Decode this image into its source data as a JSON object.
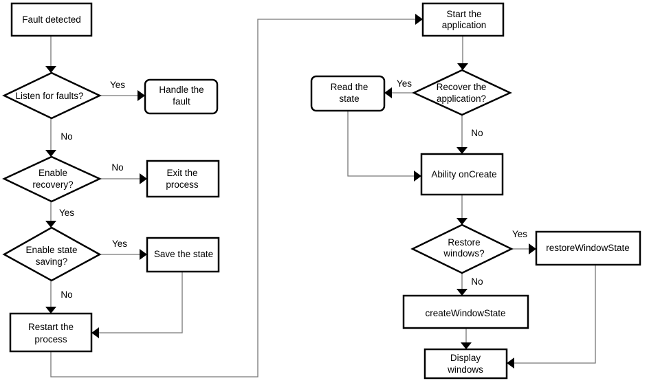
{
  "nodes": {
    "fault_detected": [
      "Fault detected"
    ],
    "listen_for_faults": [
      "Listen for faults?"
    ],
    "handle_fault": [
      "Handle the",
      "fault"
    ],
    "enable_recovery": [
      "Enable",
      "recovery?"
    ],
    "exit_process": [
      "Exit the",
      "process"
    ],
    "enable_state_saving": [
      "Enable state",
      "saving?"
    ],
    "save_state": [
      "Save the state"
    ],
    "restart_process": [
      "Restart the",
      "process"
    ],
    "start_application": [
      "Start the",
      "application"
    ],
    "recover_application": [
      "Recover the",
      "application?"
    ],
    "read_state": [
      "Read the",
      "state"
    ],
    "ability_oncreate": [
      "Ability onCreate"
    ],
    "restore_windows": [
      "Restore",
      "windows?"
    ],
    "restore_window_state": [
      "restoreWindowState"
    ],
    "create_window_state": [
      "createWindowState"
    ],
    "display_windows": [
      "Display",
      "windows"
    ]
  },
  "edge_labels": {
    "listen_yes": "Yes",
    "listen_no": "No",
    "recovery_no": "No",
    "recovery_yes": "Yes",
    "saving_yes": "Yes",
    "saving_no": "No",
    "recover_yes": "Yes",
    "recover_no": "No",
    "restore_yes": "Yes",
    "restore_no": "No"
  }
}
